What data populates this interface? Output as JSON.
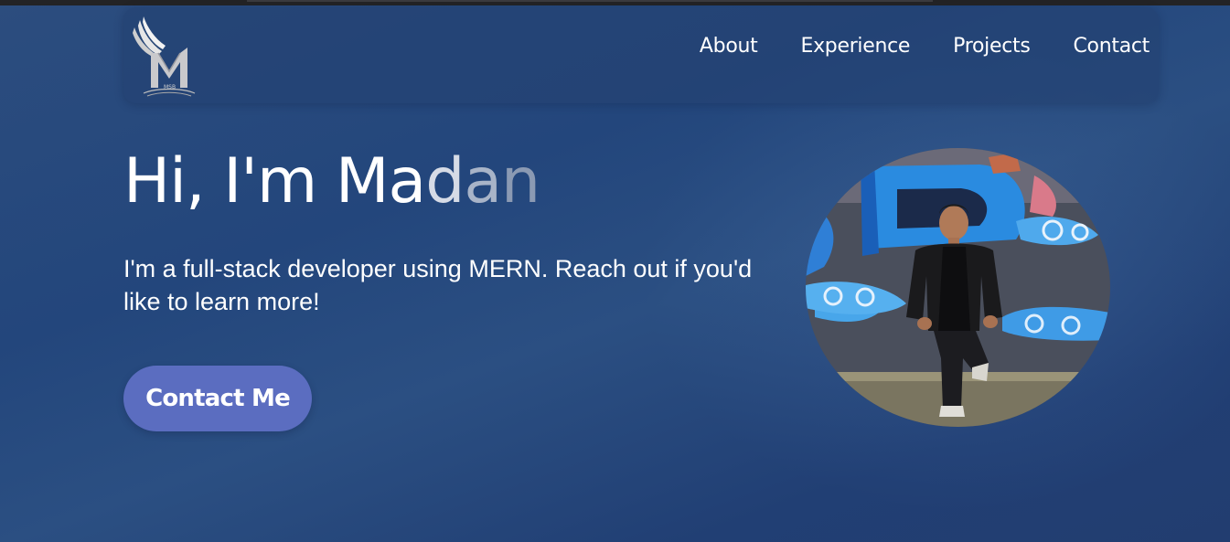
{
  "logo": {
    "text": "MSB",
    "icon": "winged-m-logo-icon"
  },
  "nav": {
    "items": [
      {
        "label": "About"
      },
      {
        "label": "Experience"
      },
      {
        "label": "Projects"
      },
      {
        "label": "Contact"
      }
    ]
  },
  "hero": {
    "greeting_solid": "Hi, I'm Ma",
    "greeting_f1": "d",
    "greeting_f2": "a",
    "greeting_f3": "n",
    "subtitle": "I'm a full-stack developer using MERN. Reach out if you'd like to learn more!",
    "cta_label": "Contact Me",
    "portrait": "portrait-photo-graffiti-wall"
  },
  "colors": {
    "background": "#23467c",
    "navbar": "#2a4a7c",
    "cta": "#5b6dc0",
    "text": "#ffffff"
  }
}
